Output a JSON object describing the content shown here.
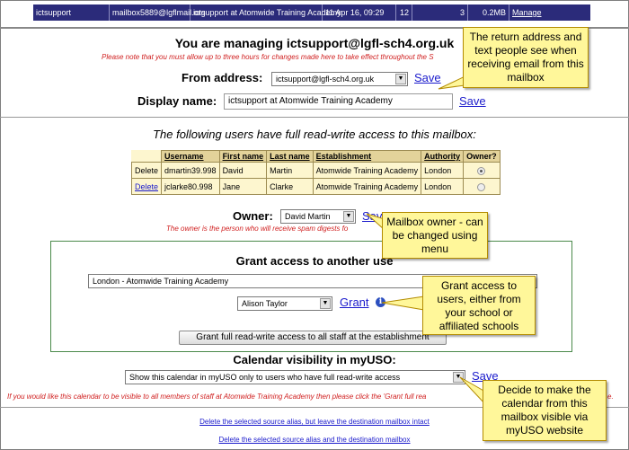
{
  "top_row": {
    "username": "ictsupport",
    "mailbox": "mailbox5889@lgflmail.org",
    "display": "ictsupport at Atomwide Training Academy",
    "date": "11 Apr 16, 09:29",
    "n1": "12",
    "n2": "3",
    "size": "0.2MB",
    "manage": "Manage"
  },
  "title": "You are managing ictsupport@lgfl-sch4.org.uk",
  "title_note": "Please note that you must allow up to three hours for changes made here to take effect throughout the S",
  "from_address": {
    "label": "From address:",
    "value": "ictsupport@lgfl-sch4.org.uk",
    "save": "Save"
  },
  "display_name": {
    "label": "Display name:",
    "value": "ictsupport at Atomwide Training Academy",
    "save": "Save"
  },
  "access_subtitle": "The following users have full read-write access to this mailbox:",
  "users_table": {
    "headers": [
      "Username",
      "First name",
      "Last name",
      "Establishment",
      "Authority",
      "Owner?"
    ],
    "rows": [
      {
        "delete": "Delete",
        "username": "dmartin39.998",
        "first": "David",
        "last": "Martin",
        "establishment": "Atomwide Training Academy",
        "authority": "London",
        "owner": true
      },
      {
        "delete": "Delete",
        "username": "jclarke80.998",
        "first": "Jane",
        "last": "Clarke",
        "establishment": "Atomwide Training Academy",
        "authority": "London",
        "owner": false
      }
    ]
  },
  "owner": {
    "label": "Owner:",
    "value": "David Martin",
    "save": "Save",
    "note": "The owner is the person who will receive spam digests fo"
  },
  "grant": {
    "title": "Grant access to another use",
    "establishment": "London - Atomwide Training Academy",
    "user": "Alison Taylor",
    "grant_link": "Grant",
    "all_staff_button": "Grant full read-write access to all staff at the establishment"
  },
  "calendar": {
    "title": "Calendar visibility in myUSO:",
    "value": "Show this calendar in myUSO only to users who have full read-write access",
    "save": "Save",
    "note": "If you would like this calendar to be visible to all members of staff at Atomwide Training Academy then please click the 'Grant full rea",
    "note_tail": "e."
  },
  "footer_links": [
    "Delete the selected source alias, but leave the destination mailbox intact",
    "Delete the selected source alias and the destination mailbox"
  ],
  "callouts": {
    "return_address": "The return address and text people see when receiving email from this mailbox",
    "owner_change": "Mailbox owner - can be changed using menu",
    "grant_access": "Grant access to users, either from your school or affiliated schools",
    "calendar_visible": "Decide to make the calendar from this mailbox visible via myUSO website"
  },
  "icons": [
    "dropdown-arrow-icon",
    "info-icon"
  ],
  "colors": {
    "link": "#1a1acc",
    "note_red": "#d02020",
    "callout_bg": "#fff79a",
    "table_header": "#e3d39a",
    "top_row_bg": "#2b2b7a"
  }
}
